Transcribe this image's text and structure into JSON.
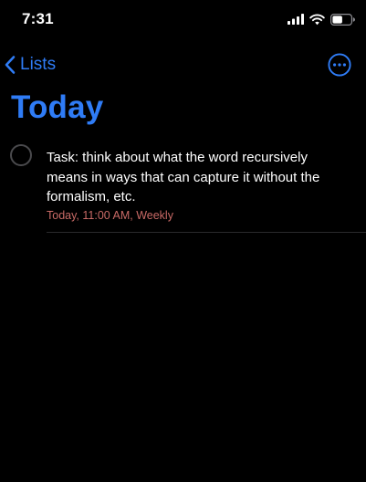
{
  "status_bar": {
    "time": "7:31",
    "icons": [
      "cellular-signal-icon",
      "wifi-icon",
      "battery-icon"
    ]
  },
  "nav": {
    "back_label": "Lists",
    "back_icon": "chevron-left-icon",
    "more_icon": "ellipsis-circle-icon"
  },
  "page": {
    "title": "Today"
  },
  "tasks": [
    {
      "title": "Task: think about what the word recursively means in ways that can capture it without the formalism, etc.",
      "meta": "Today, 11:00 AM, Weekly",
      "completed": false
    }
  ],
  "colors": {
    "accent": "#2f7cf6",
    "background": "#000000",
    "text": "#ffffff",
    "meta_text": "#c96a66",
    "checkbox_border": "#4a4a4d",
    "divider": "#2a2a2c"
  }
}
